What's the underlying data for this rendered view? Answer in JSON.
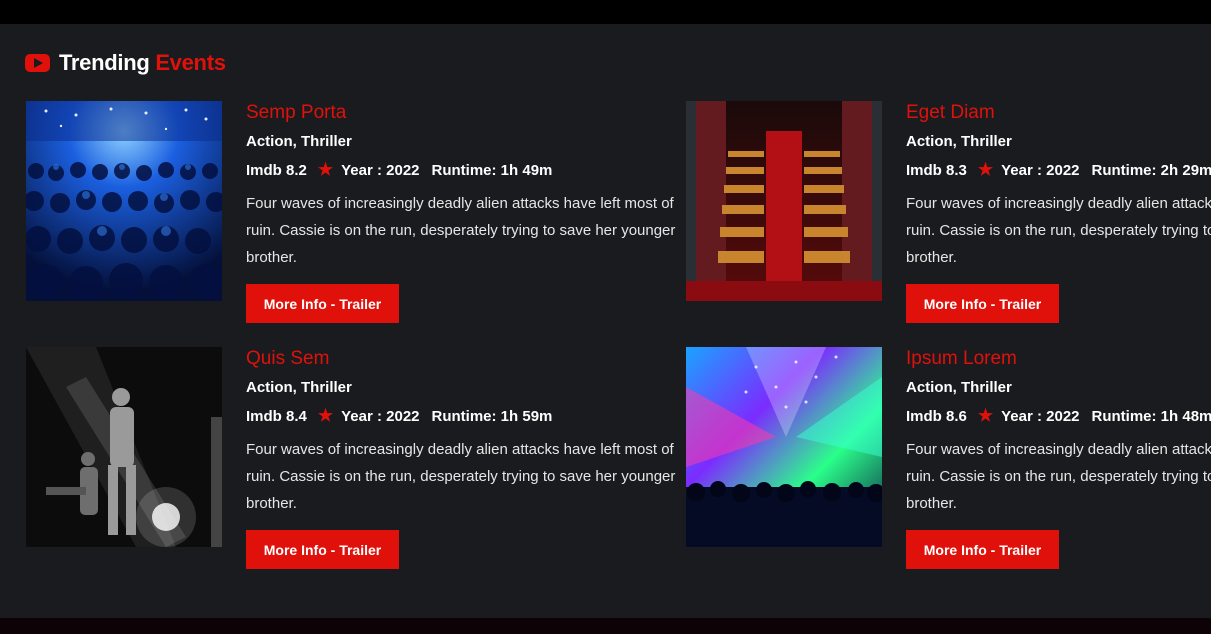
{
  "section": {
    "title": "Trending",
    "title_accent": "Events"
  },
  "events": [
    {
      "title": "Semp Porta",
      "genre": "Action, Thriller",
      "imdb": "Imdb 8.2",
      "year": "Year : 2022",
      "runtime": "Runtime: 1h 49m",
      "description": "Four waves of increasingly deadly alien attacks have left most of ruin. Cassie is on the run, desperately trying to save her younger brother.",
      "button": "More Info - Trailer",
      "image": "concert-crowd-blue"
    },
    {
      "title": "Eget Diam",
      "genre": "Action, Thriller",
      "imdb": "Imdb 8.3",
      "year": "Year : 2022",
      "runtime": "Runtime: 2h 29m",
      "description": "Four waves of increasingly deadly alien attacks have left most of ruin. Cassie is on the run, desperately trying to save her younger brother.",
      "button": "More Info - Trailer",
      "image": "theater-seats-red"
    },
    {
      "title": "Quis Sem",
      "genre": "Action, Thriller",
      "imdb": "Imdb 8.4",
      "year": "Year : 2022",
      "runtime": "Runtime: 1h 59m",
      "description": "Four waves of increasingly deadly alien attacks have left most of ruin. Cassie is on the run, desperately trying to save her younger brother.",
      "button": "More Info - Trailer",
      "image": "band-stage-bw"
    },
    {
      "title": "Ipsum Lorem",
      "genre": "Action, Thriller",
      "imdb": "Imdb 8.6",
      "year": "Year : 2022",
      "runtime": "Runtime: 1h 48m",
      "description": "Four waves of increasingly deadly alien attacks have left most of ruin. Cassie is on the run, desperately trying to save her younger brother.",
      "button": "More Info - Trailer",
      "image": "festival-lights"
    }
  ],
  "colors": {
    "accent": "#e0110b",
    "background": "#1a1b1f"
  },
  "icons": {
    "section": "youtube-play-icon",
    "rating": "star-icon"
  }
}
